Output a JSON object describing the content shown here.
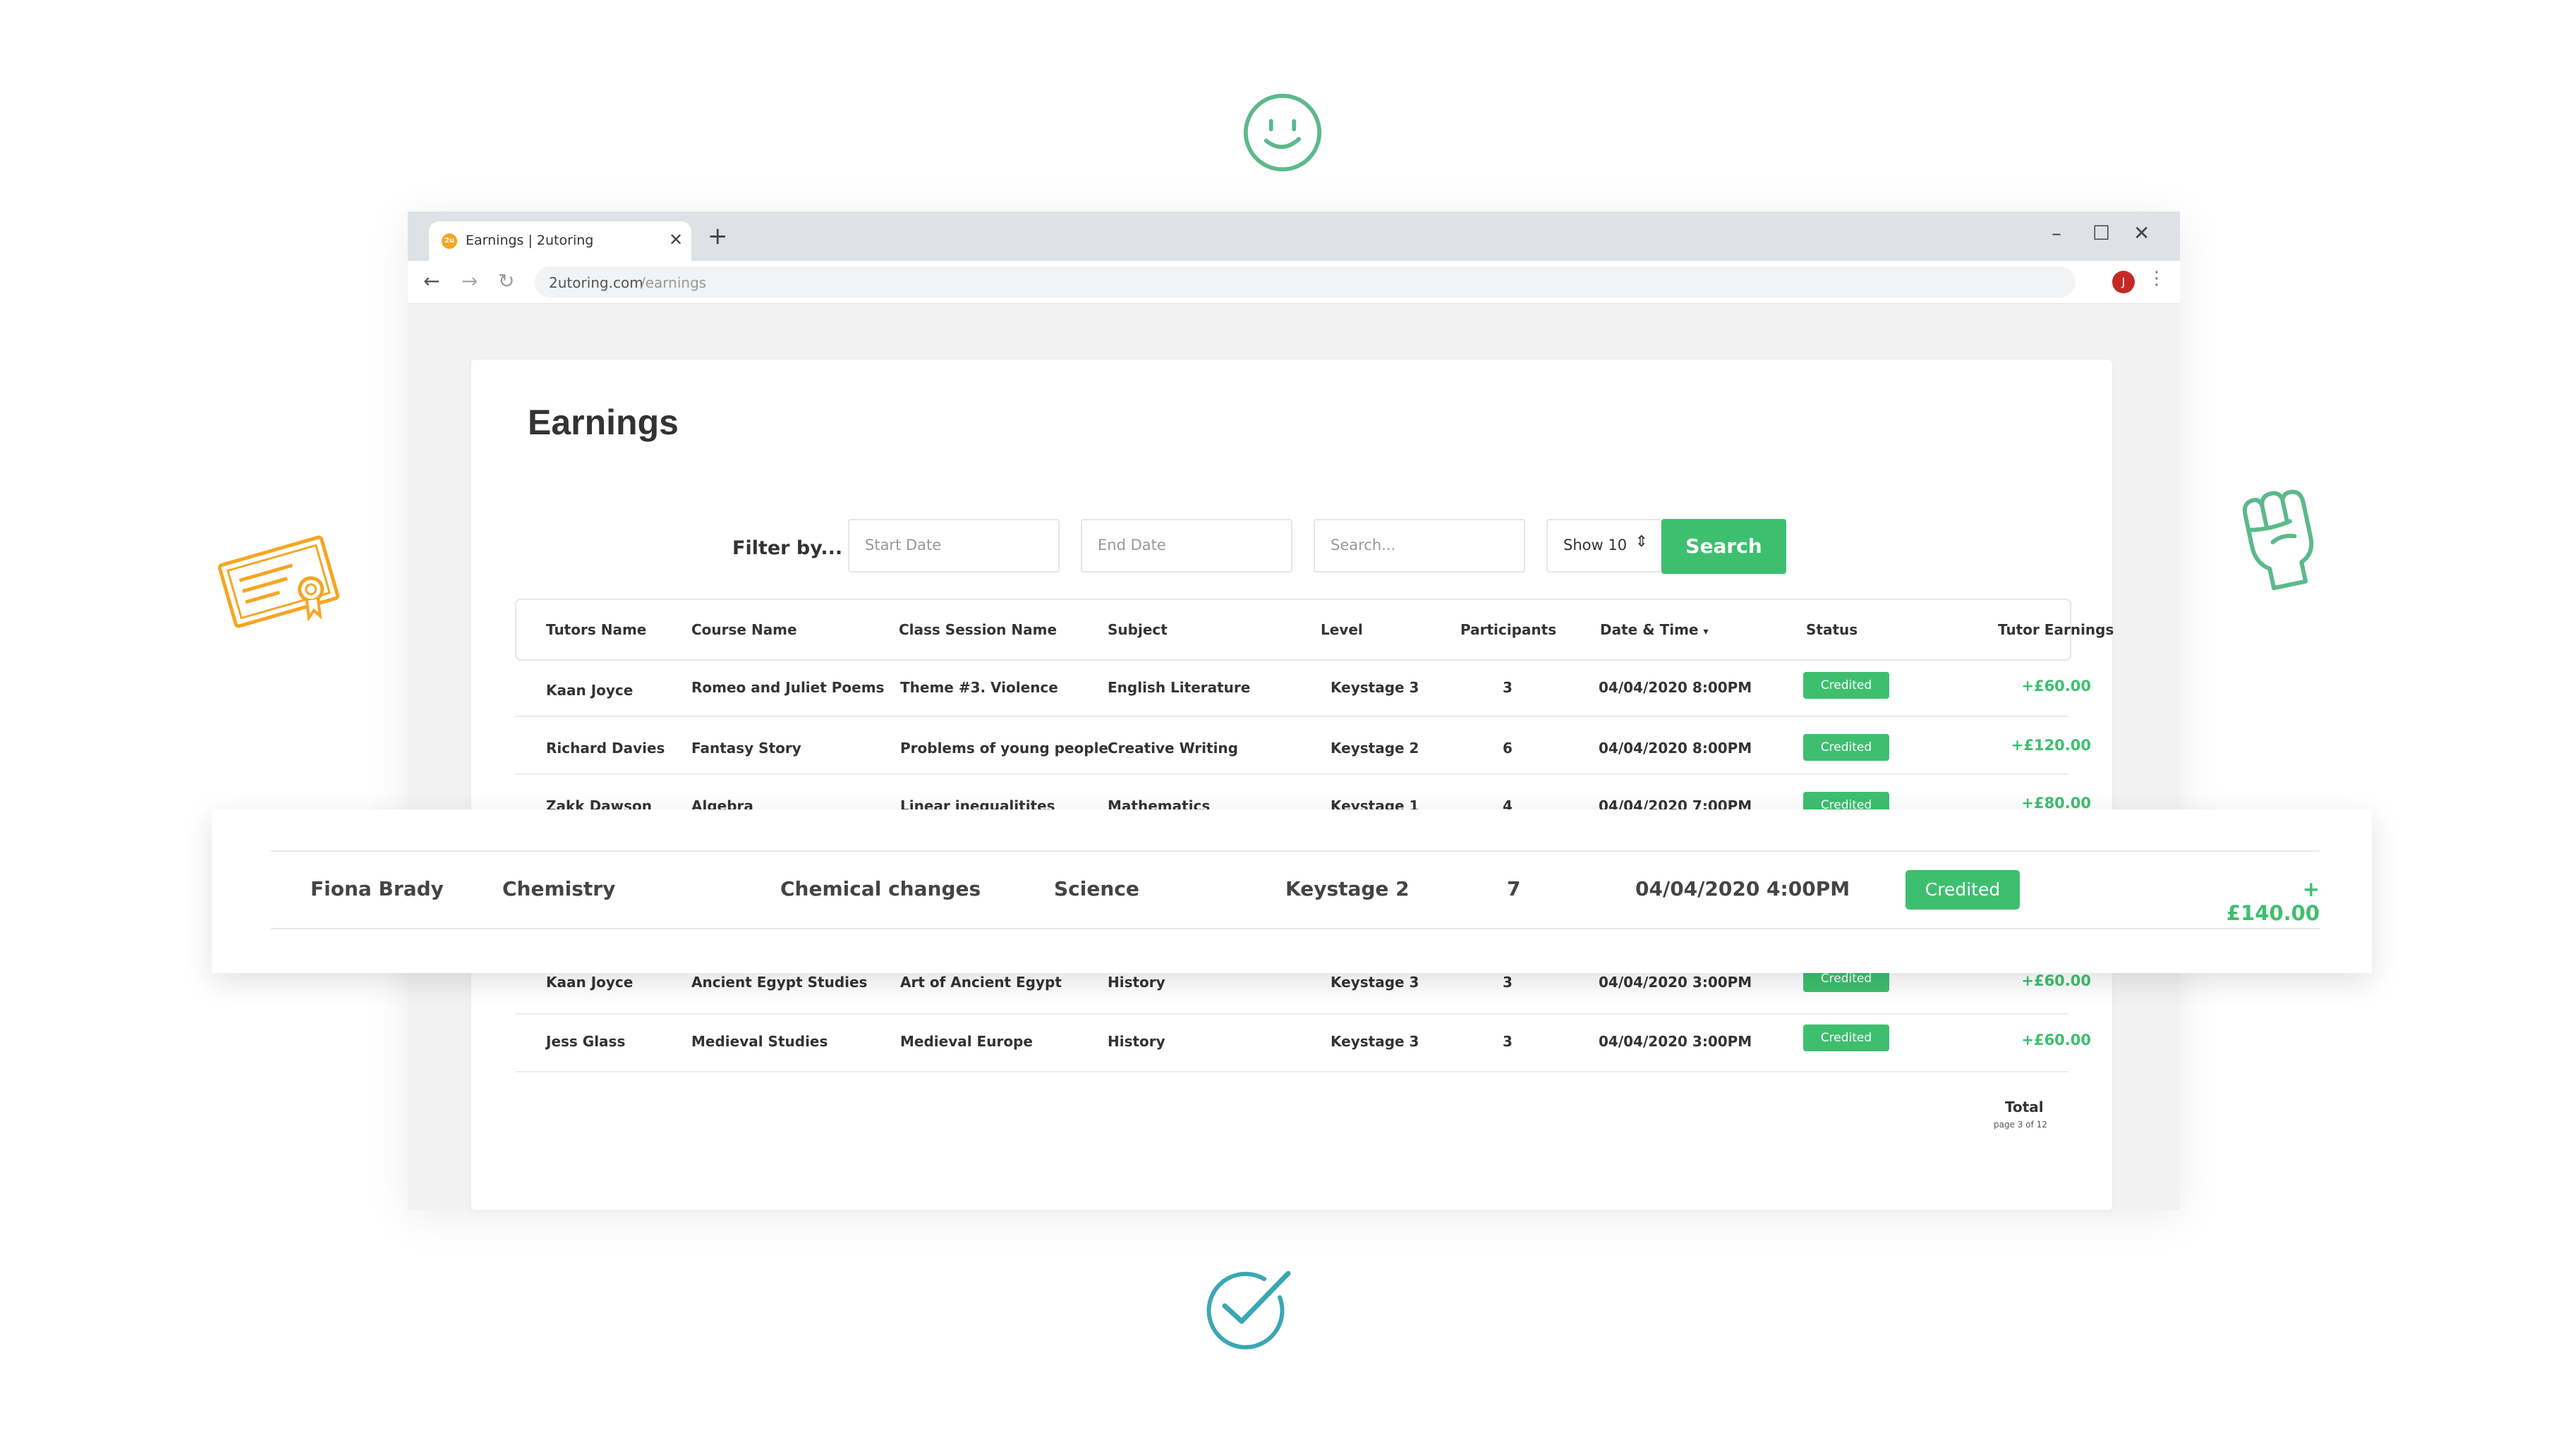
{
  "colors": {
    "accent_green": "#3ebf6f",
    "icon_green": "#5cb98a",
    "icon_orange": "#f5a623",
    "icon_teal": "#3aa7b3"
  },
  "decorations": {
    "top": "smiley-icon",
    "left": "certificate-icon",
    "right": "raised-fist-icon",
    "bottom": "checkmark-icon"
  },
  "browser": {
    "tab_title": "Earnings | 2utoring",
    "favicon_text": "2u",
    "url_host": "2utoring.com",
    "url_path": "/earnings",
    "profile_initial": "J"
  },
  "page": {
    "title": "Earnings",
    "filter_label": "Filter by...",
    "start_date_placeholder": "Start Date",
    "end_date_placeholder": "End Date",
    "search_placeholder": "Search...",
    "show_select": "Show 10",
    "search_button": "Search"
  },
  "table": {
    "headers": [
      "Tutors Name",
      "Course Name",
      "Class Session Name",
      "Subject",
      "Level",
      "Participants",
      "Date & Time",
      "Status",
      "Tutor Earnings"
    ],
    "rows": [
      {
        "tutor": "Kaan Joyce",
        "course": "Romeo and Juliet Poems",
        "session": "Theme #3. Violence",
        "subject": "English Literature",
        "level": "Keystage 3",
        "participants": "3",
        "datetime": "04/04/2020 8:00PM",
        "status": "Credited",
        "earnings": "+£60.00"
      },
      {
        "tutor": "Richard Davies",
        "course": "Fantasy Story",
        "session": "Problems of young people",
        "subject": "Creative Writing",
        "level": "Keystage 2",
        "participants": "6",
        "datetime": "04/04/2020 8:00PM",
        "status": "Credited",
        "earnings": "+£120.00"
      },
      {
        "tutor": "Zakk Dawson",
        "course": "Algebra",
        "session": "Linear inequalitites",
        "subject": "Mathematics",
        "level": "Keystage 1",
        "participants": "4",
        "datetime": "04/04/2020 7:00PM",
        "status": "Credited",
        "earnings": "+£80.00"
      },
      {
        "tutor": "Kaan Joyce",
        "course": "Ancient Egypt Studies",
        "session": "Art of Ancient Egypt",
        "subject": "History",
        "level": "Keystage 3",
        "participants": "3",
        "datetime": "04/04/2020 3:00PM",
        "status": "Credited",
        "earnings": "+£60.00"
      },
      {
        "tutor": "Jess Glass",
        "course": "Medieval Studies",
        "session": "Medieval Europe",
        "subject": "History",
        "level": "Keystage 3",
        "participants": "3",
        "datetime": "04/04/2020 3:00PM",
        "status": "Credited",
        "earnings": "+£60.00"
      }
    ],
    "highlighted_row": {
      "tutor": "Fiona Brady",
      "course": "Chemistry",
      "session": "Chemical changes",
      "subject": "Science",
      "level": "Keystage 2",
      "participants": "7",
      "datetime": "04/04/2020 4:00PM",
      "status": "Credited",
      "earnings": "+£140.00"
    },
    "total_label": "Total",
    "page_info": "page 3 of 12"
  }
}
